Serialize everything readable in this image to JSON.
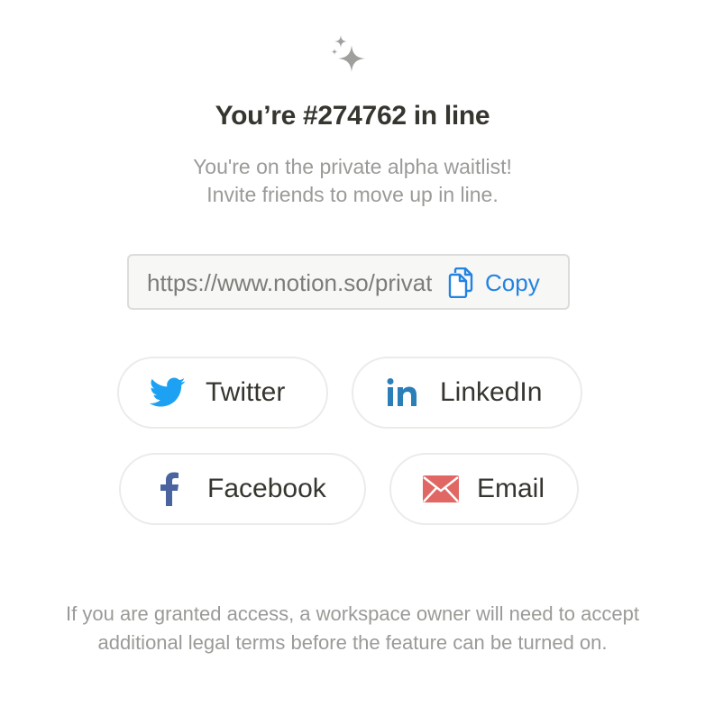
{
  "header": {
    "icon": "sparkle-icon",
    "title": "You’re #274762 in line",
    "subtitle_line1": "You're on the private alpha waitlist!",
    "subtitle_line2": "Invite friends to move up in line."
  },
  "invite": {
    "url_value": "https://www.notion.so/private-alpha",
    "copy_label": "Copy",
    "copy_icon": "copy-icon"
  },
  "share": {
    "twitter": {
      "label": "Twitter",
      "icon": "twitter-icon",
      "color": "#1da1f2"
    },
    "linkedin": {
      "label": "LinkedIn",
      "icon": "linkedin-icon",
      "color": "#2a7fb8"
    },
    "facebook": {
      "label": "Facebook",
      "icon": "facebook-icon",
      "color": "#4b64a0"
    },
    "email": {
      "label": "Email",
      "icon": "envelope-icon",
      "color": "#e06763"
    }
  },
  "footer": {
    "note": "If you are granted access, a workspace owner will need to accept additional legal terms before the feature can be turned on."
  }
}
